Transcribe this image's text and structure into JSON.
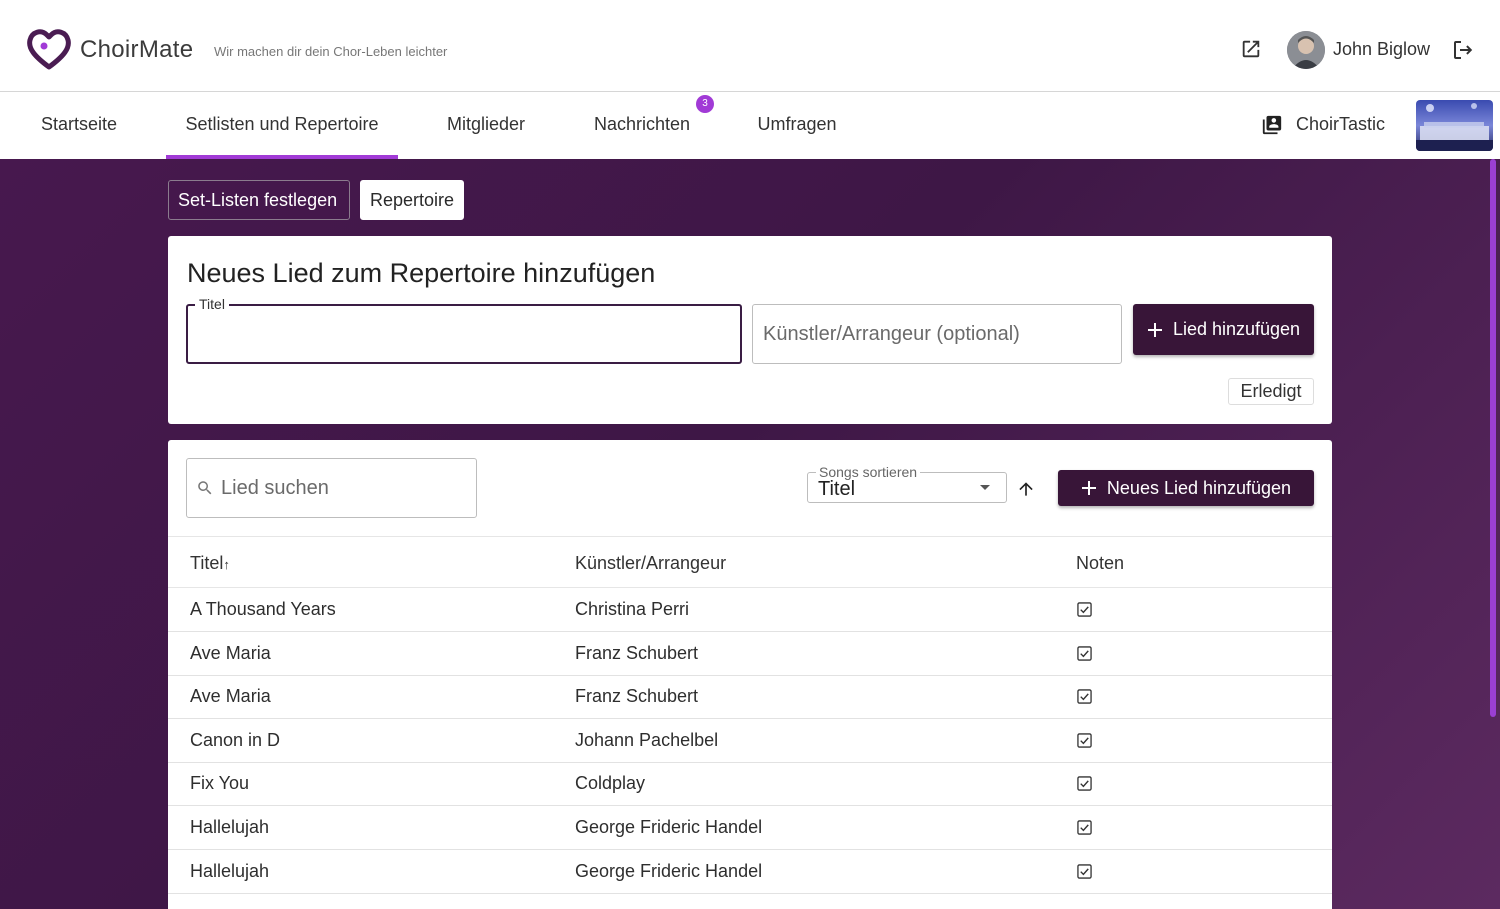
{
  "app": {
    "brand": "ChoirMate",
    "tagline": "Wir machen dir dein Chor-Leben leichter"
  },
  "user": {
    "name": "John Biglow"
  },
  "nav": {
    "tabs": [
      {
        "label": "Startseite"
      },
      {
        "label": "Setlisten und Repertoire",
        "active": true
      },
      {
        "label": "Mitglieder"
      },
      {
        "label": "Nachrichten",
        "badge": "3"
      },
      {
        "label": "Umfragen"
      }
    ],
    "choir_name": "ChoirTastic"
  },
  "subtabs": {
    "setlists": "Set-Listen festlegen",
    "repertoire": "Repertoire"
  },
  "add_form": {
    "heading": "Neues Lied zum Repertoire hinzufügen",
    "title_label": "Titel",
    "title_value": "",
    "artist_placeholder": "Künstler/Arrangeur (optional)",
    "add_button": "Lied hinzufügen",
    "done_button": "Erledigt"
  },
  "list": {
    "search_placeholder": "Lied suchen",
    "sort_label": "Songs sortieren",
    "sort_value": "Titel",
    "new_song_button": "Neues Lied hinzufügen",
    "columns": {
      "title": "Titel",
      "title_sort_indicator": "↑",
      "artist": "Künstler/Arrangeur",
      "notes": "Noten"
    },
    "rows": [
      {
        "title": "A Thousand Years",
        "artist": "Christina Perri",
        "has_notes": true
      },
      {
        "title": "Ave Maria",
        "artist": "Franz Schubert",
        "has_notes": true
      },
      {
        "title": "Ave Maria",
        "artist": "Franz Schubert",
        "has_notes": true
      },
      {
        "title": "Canon in D",
        "artist": "Johann Pachelbel",
        "has_notes": true
      },
      {
        "title": "Fix You",
        "artist": "Coldplay",
        "has_notes": true
      },
      {
        "title": "Hallelujah",
        "artist": "George Frideric Handel",
        "has_notes": true
      },
      {
        "title": "Hallelujah",
        "artist": "George Frideric Handel",
        "has_notes": true
      }
    ]
  },
  "colors": {
    "accent": "#a13ad6",
    "primary_dark": "#381538",
    "background": "#43184b"
  }
}
